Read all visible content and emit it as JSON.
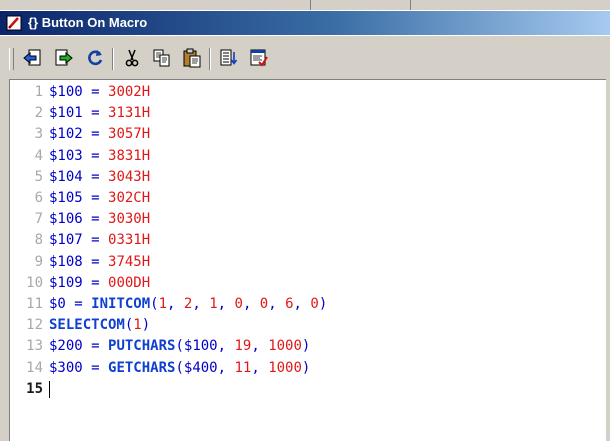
{
  "window": {
    "title": "{} Button On Macro"
  },
  "toolbar": {
    "buttons": [
      {
        "name": "import-macro-button",
        "icon": "import-arrow-icon"
      },
      {
        "name": "export-macro-button",
        "icon": "export-arrow-icon"
      },
      {
        "name": "refresh-button",
        "icon": "refresh-icon"
      },
      {
        "name": "cut-button",
        "icon": "scissors-icon"
      },
      {
        "name": "copy-button",
        "icon": "copy-icon"
      },
      {
        "name": "paste-button",
        "icon": "paste-icon"
      },
      {
        "name": "insert-command-button",
        "icon": "list-insert-icon"
      },
      {
        "name": "check-syntax-button",
        "icon": "check-document-icon"
      }
    ]
  },
  "colors": {
    "variable": "#0000c8",
    "number": "#e01818",
    "function": "#1040d0",
    "line_number": "#a8a8a8"
  },
  "editor": {
    "current_line": 15,
    "lines": [
      {
        "n": "1",
        "tokens": [
          {
            "t": "$100",
            "c": "var"
          },
          {
            "t": " = ",
            "c": "op"
          },
          {
            "t": "3002H",
            "c": "num"
          }
        ]
      },
      {
        "n": "2",
        "tokens": [
          {
            "t": "$101",
            "c": "var"
          },
          {
            "t": " = ",
            "c": "op"
          },
          {
            "t": "3131H",
            "c": "num"
          }
        ]
      },
      {
        "n": "3",
        "tokens": [
          {
            "t": "$102",
            "c": "var"
          },
          {
            "t": " = ",
            "c": "op"
          },
          {
            "t": "3057H",
            "c": "num"
          }
        ]
      },
      {
        "n": "4",
        "tokens": [
          {
            "t": "$103",
            "c": "var"
          },
          {
            "t": " = ",
            "c": "op"
          },
          {
            "t": "3831H",
            "c": "num"
          }
        ]
      },
      {
        "n": "5",
        "tokens": [
          {
            "t": "$104",
            "c": "var"
          },
          {
            "t": " = ",
            "c": "op"
          },
          {
            "t": "3043H",
            "c": "num"
          }
        ]
      },
      {
        "n": "6",
        "tokens": [
          {
            "t": "$105",
            "c": "var"
          },
          {
            "t": " = ",
            "c": "op"
          },
          {
            "t": "302CH",
            "c": "num"
          }
        ]
      },
      {
        "n": "7",
        "tokens": [
          {
            "t": "$106",
            "c": "var"
          },
          {
            "t": " = ",
            "c": "op"
          },
          {
            "t": "3030H",
            "c": "num"
          }
        ]
      },
      {
        "n": "8",
        "tokens": [
          {
            "t": "$107",
            "c": "var"
          },
          {
            "t": " = ",
            "c": "op"
          },
          {
            "t": "0331H",
            "c": "num"
          }
        ]
      },
      {
        "n": "9",
        "tokens": [
          {
            "t": "$108",
            "c": "var"
          },
          {
            "t": " = ",
            "c": "op"
          },
          {
            "t": "3745H",
            "c": "num"
          }
        ]
      },
      {
        "n": "10",
        "tokens": [
          {
            "t": "$109",
            "c": "var"
          },
          {
            "t": " = ",
            "c": "op"
          },
          {
            "t": "000DH",
            "c": "num"
          }
        ]
      },
      {
        "n": "11",
        "tokens": [
          {
            "t": "$0",
            "c": "var"
          },
          {
            "t": " = ",
            "c": "op"
          },
          {
            "t": "INITCOM",
            "c": "fn"
          },
          {
            "t": "(",
            "c": "pun"
          },
          {
            "t": "1",
            "c": "num"
          },
          {
            "t": ", ",
            "c": "pun"
          },
          {
            "t": "2",
            "c": "num"
          },
          {
            "t": ", ",
            "c": "pun"
          },
          {
            "t": "1",
            "c": "num"
          },
          {
            "t": ", ",
            "c": "pun"
          },
          {
            "t": "0",
            "c": "num"
          },
          {
            "t": ", ",
            "c": "pun"
          },
          {
            "t": "0",
            "c": "num"
          },
          {
            "t": ", ",
            "c": "pun"
          },
          {
            "t": "6",
            "c": "num"
          },
          {
            "t": ", ",
            "c": "pun"
          },
          {
            "t": "0",
            "c": "num"
          },
          {
            "t": ")",
            "c": "pun"
          }
        ]
      },
      {
        "n": "12",
        "tokens": [
          {
            "t": "SELECTCOM",
            "c": "fn"
          },
          {
            "t": "(",
            "c": "pun"
          },
          {
            "t": "1",
            "c": "num"
          },
          {
            "t": ")",
            "c": "pun"
          }
        ]
      },
      {
        "n": "13",
        "tokens": [
          {
            "t": "$200",
            "c": "var"
          },
          {
            "t": " = ",
            "c": "op"
          },
          {
            "t": "PUTCHARS",
            "c": "fn"
          },
          {
            "t": "(",
            "c": "pun"
          },
          {
            "t": "$100",
            "c": "var"
          },
          {
            "t": ", ",
            "c": "pun"
          },
          {
            "t": "19",
            "c": "num"
          },
          {
            "t": ", ",
            "c": "pun"
          },
          {
            "t": "1000",
            "c": "num"
          },
          {
            "t": ")",
            "c": "pun"
          }
        ]
      },
      {
        "n": "14",
        "tokens": [
          {
            "t": "$300",
            "c": "var"
          },
          {
            "t": " = ",
            "c": "op"
          },
          {
            "t": "GETCHARS",
            "c": "fn"
          },
          {
            "t": "(",
            "c": "pun"
          },
          {
            "t": "$400",
            "c": "var"
          },
          {
            "t": ", ",
            "c": "pun"
          },
          {
            "t": "11",
            "c": "num"
          },
          {
            "t": ", ",
            "c": "pun"
          },
          {
            "t": "1000",
            "c": "num"
          },
          {
            "t": ")",
            "c": "pun"
          }
        ]
      },
      {
        "n": "15",
        "tokens": []
      }
    ]
  }
}
